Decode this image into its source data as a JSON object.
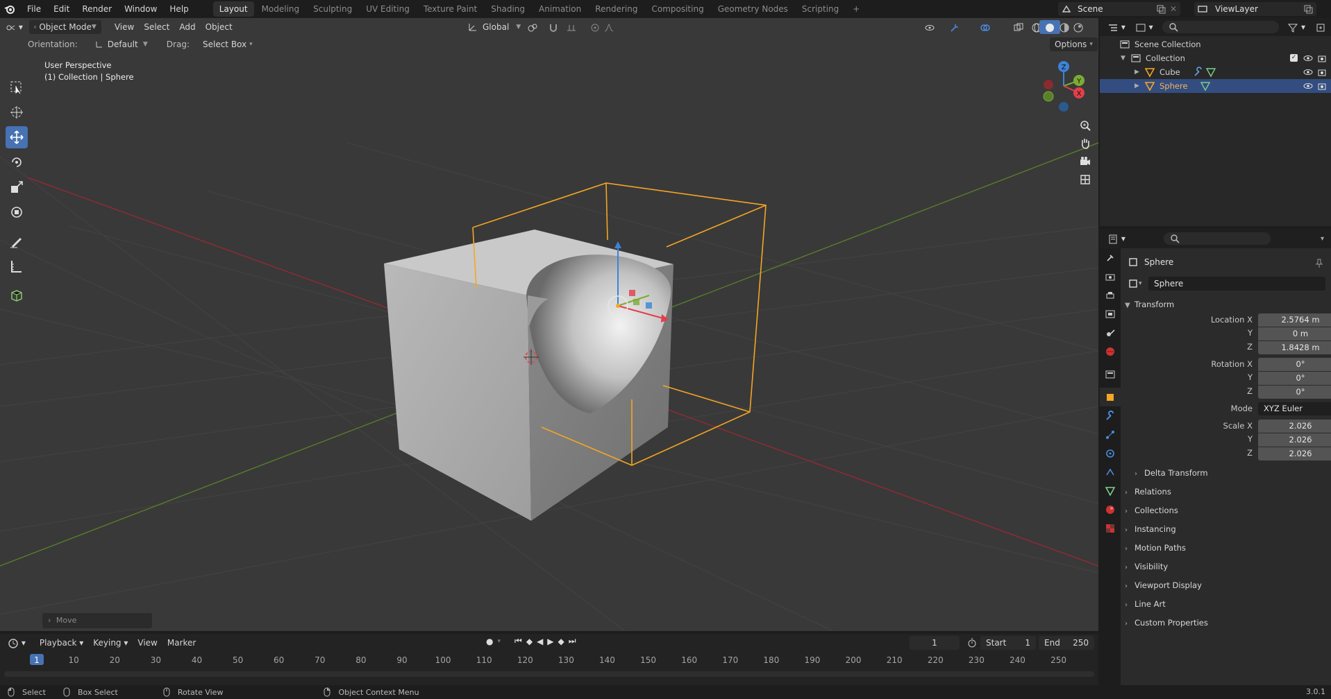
{
  "top_menu": {
    "items": [
      "File",
      "Edit",
      "Render",
      "Window",
      "Help"
    ],
    "workspace_tabs": [
      "Layout",
      "Modeling",
      "Sculpting",
      "UV Editing",
      "Texture Paint",
      "Shading",
      "Animation",
      "Rendering",
      "Compositing",
      "Geometry Nodes",
      "Scripting"
    ],
    "active_tab": "Layout",
    "add_tab": "+",
    "scene_name": "Scene",
    "view_layer": "ViewLayer"
  },
  "viewport": {
    "mode": "Object Mode",
    "menus": [
      "View",
      "Select",
      "Add",
      "Object"
    ],
    "transform_orientation": "Global",
    "orientation_label": "Orientation:",
    "orientation_value": "Default",
    "drag_label": "Drag:",
    "drag_value": "Select Box",
    "options_label": "Options",
    "perspective_text": "User Perspective",
    "context_text": "(1) Collection | Sphere",
    "last_operator": "Move",
    "gizmo_labels": {
      "x": "X",
      "y": "Y",
      "z": "Z"
    }
  },
  "toolbar": {
    "tools": [
      "select-box-icon",
      "cursor-icon",
      "move-icon",
      "rotate-icon",
      "scale-icon",
      "transform-icon",
      "annotate-icon",
      "measure-icon",
      "add-cube-icon"
    ],
    "active_tool": "move-icon"
  },
  "timeline": {
    "menus": [
      "Playback",
      "Keying",
      "View",
      "Marker"
    ],
    "current_frame": "1",
    "start_label": "Start",
    "start_value": "1",
    "end_label": "End",
    "end_value": "250",
    "ruler": [
      "1",
      "10",
      "20",
      "30",
      "40",
      "50",
      "60",
      "70",
      "80",
      "90",
      "100",
      "110",
      "120",
      "130",
      "140",
      "150",
      "160",
      "170",
      "180",
      "190",
      "200",
      "210",
      "220",
      "230",
      "240",
      "250"
    ]
  },
  "statusbar": {
    "items": [
      "Select",
      "Box Select",
      "Rotate View",
      "Object Context Menu"
    ],
    "version": "3.0.1"
  },
  "outliner": {
    "root": "Scene Collection",
    "collection": "Collection",
    "objects": [
      {
        "name": "Cube",
        "selected": false
      },
      {
        "name": "Sphere",
        "selected": true
      }
    ]
  },
  "properties": {
    "object_name": "Sphere",
    "datablock_name": "Sphere",
    "transform_title": "Transform",
    "location_label": "Location X",
    "location": [
      "2.5764 m",
      "0 m",
      "1.8428 m"
    ],
    "rotation_label": "Rotation X",
    "rotation": [
      "0°",
      "0°",
      "0°"
    ],
    "axis_labels": [
      "Y",
      "Z"
    ],
    "mode_label": "Mode",
    "mode_value": "XYZ Euler",
    "scale_label": "Scale X",
    "scale": [
      "2.026",
      "2.026",
      "2.026"
    ],
    "subpanels": [
      "Delta Transform"
    ],
    "panels": [
      "Relations",
      "Collections",
      "Instancing",
      "Motion Paths",
      "Visibility",
      "Viewport Display",
      "Line Art",
      "Custom Properties"
    ]
  },
  "colors": {
    "accent": "#4772b3",
    "selection_orange": "#f5a623",
    "axis_x": "#e23f4a",
    "axis_y": "#7cab33",
    "axis_z": "#3b84d8"
  }
}
